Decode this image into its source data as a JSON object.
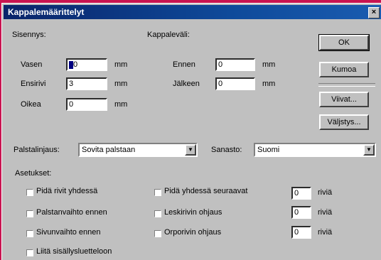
{
  "window": {
    "title": "Kappalemäärittelyt",
    "close_label": "×"
  },
  "indent": {
    "title": "Sisennys:",
    "left_label": "Vasen",
    "left_value": "0",
    "first_label": "Ensirivi",
    "first_value": "3",
    "right_label": "Oikea",
    "right_value": "0",
    "unit": "mm"
  },
  "spacing": {
    "title": "Kappaleväli:",
    "before_label": "Ennen",
    "before_value": "0",
    "after_label": "Jälkeen",
    "after_value": "0",
    "unit": "mm"
  },
  "buttons": {
    "ok": "OK",
    "cancel": "Kumoa",
    "lines": "Viivat...",
    "colors": "Väljstys..."
  },
  "column_align": {
    "label": "Palstalinjaus:",
    "value": "Sovita palstaan"
  },
  "dictionary": {
    "label": "Sanasto:",
    "value": "Suomi"
  },
  "settings": {
    "title": "Asetukset:",
    "keep_lines": "Pidä rivit yhdessä",
    "column_break": "Palstanvaihto ennen",
    "page_break": "Sivunvaihto ennen",
    "toc": "Liitä sisällysluetteloon",
    "keep_next": "Pidä yhdessä seuraavat",
    "widow": "Leskirivin ohjaus",
    "orphan": "Orporivin ohjaus",
    "keep_next_value": "0",
    "widow_value": "0",
    "orphan_value": "0",
    "rows_unit": "riviä"
  }
}
